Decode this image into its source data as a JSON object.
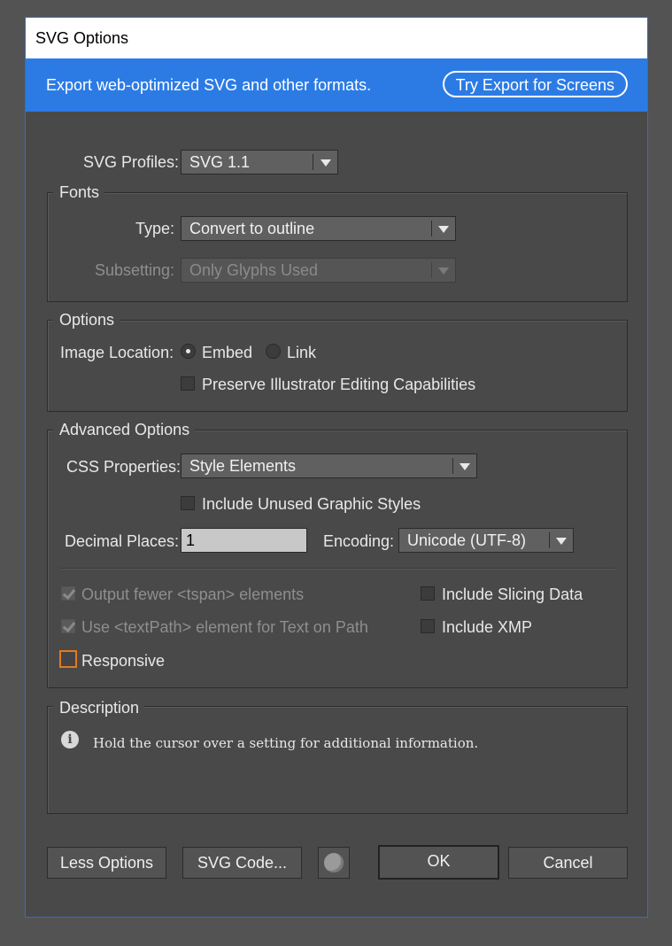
{
  "window": {
    "title": "SVG Options"
  },
  "banner": {
    "text": "Export web-optimized SVG and other formats.",
    "button_label": "Try Export for Screens",
    "color": "#2c7be5"
  },
  "profiles": {
    "label": "SVG Profiles:",
    "value": "SVG 1.1"
  },
  "fonts": {
    "title": "Fonts",
    "type_label": "Type:",
    "type_value": "Convert to outline",
    "subsetting_label": "Subsetting:",
    "subsetting_value": "Only Glyphs Used"
  },
  "options": {
    "title": "Options",
    "image_location_label": "Image Location:",
    "embed_label": "Embed",
    "link_label": "Link",
    "image_location_selected": "Embed",
    "preserve_label": "Preserve Illustrator Editing Capabilities"
  },
  "advanced": {
    "title": "Advanced Options",
    "css_label": "CSS Properties:",
    "css_value": "Style Elements",
    "unused_styles_label": "Include Unused Graphic Styles",
    "decimal_label": "Decimal Places:",
    "decimal_value": "1",
    "encoding_label": "Encoding:",
    "encoding_value": "Unicode (UTF-8)",
    "tspan_label": "Output fewer <tspan> elements",
    "textpath_label": "Use <textPath> element for Text on Path",
    "responsive_label": "Responsive",
    "slicing_label": "Include Slicing Data",
    "xmp_label": "Include XMP"
  },
  "description": {
    "title": "Description",
    "text": "Hold the cursor over a setting for additional information."
  },
  "buttons": {
    "less_options": "Less Options",
    "svg_code": "SVG Code...",
    "ok": "OK",
    "cancel": "Cancel"
  }
}
